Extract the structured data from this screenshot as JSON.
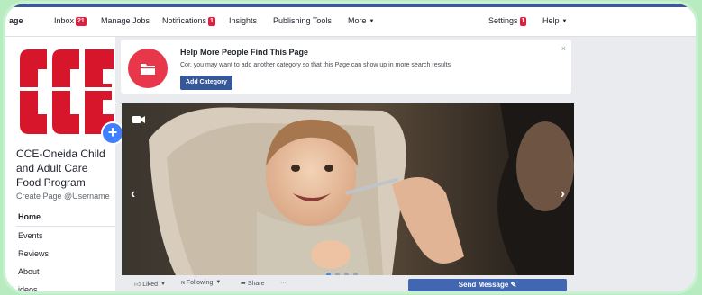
{
  "topnav": {
    "items": [
      {
        "label": "age",
        "active": true
      },
      {
        "label": "Inbox",
        "badge": "21"
      },
      {
        "label": "Manage Jobs"
      },
      {
        "label": "Notifications",
        "badge": "1"
      },
      {
        "label": "Insights"
      },
      {
        "label": "Publishing Tools"
      },
      {
        "label": "More"
      }
    ],
    "settings": {
      "label": "Settings",
      "badge": "1"
    },
    "help": {
      "label": "Help"
    }
  },
  "sidebar": {
    "logo_icon": "cce-logo",
    "page_name": "CCE-Oneida Child and Adult Care Food Program",
    "create_username": "Create Page @Username",
    "menu": [
      {
        "label": "Home",
        "active": true
      },
      {
        "label": "Events"
      },
      {
        "label": "Reviews"
      },
      {
        "label": "About"
      },
      {
        "label": "ideos"
      }
    ]
  },
  "notice": {
    "title": "Help More People Find This Page",
    "description": "Cor, you may want to add another category so that this Page can show up in more search results",
    "button": "Add Category",
    "close": "×"
  },
  "cover": {
    "prev": "‹",
    "next": "›",
    "slide_count": 4,
    "active_slide": 1
  },
  "actions": {
    "liked": "Liked",
    "following": "Following",
    "share": "Share",
    "more": "···",
    "send_message": "Send Message"
  },
  "colors": {
    "accent": "#3b5998",
    "button": "#4267b2",
    "badge": "#e41e3f",
    "logo_red": "#d7152b"
  }
}
